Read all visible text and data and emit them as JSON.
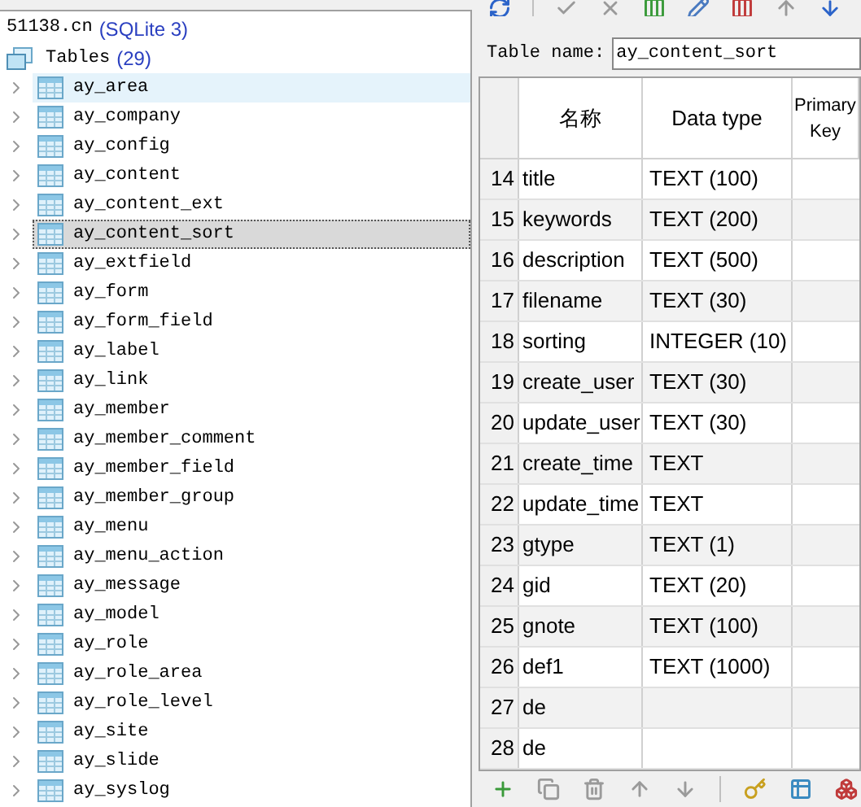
{
  "database": {
    "name": "51138.cn",
    "engine": "(SQLite 3)"
  },
  "tables_node": {
    "label": "Tables",
    "count": "(29)"
  },
  "tables": [
    {
      "name": "ay_area",
      "selected": false,
      "hovered": true
    },
    {
      "name": "ay_company",
      "selected": false,
      "hovered": false
    },
    {
      "name": "ay_config",
      "selected": false,
      "hovered": false
    },
    {
      "name": "ay_content",
      "selected": false,
      "hovered": false
    },
    {
      "name": "ay_content_ext",
      "selected": false,
      "hovered": false
    },
    {
      "name": "ay_content_sort",
      "selected": true,
      "hovered": false
    },
    {
      "name": "ay_extfield",
      "selected": false,
      "hovered": false
    },
    {
      "name": "ay_form",
      "selected": false,
      "hovered": false
    },
    {
      "name": "ay_form_field",
      "selected": false,
      "hovered": false
    },
    {
      "name": "ay_label",
      "selected": false,
      "hovered": false
    },
    {
      "name": "ay_link",
      "selected": false,
      "hovered": false
    },
    {
      "name": "ay_member",
      "selected": false,
      "hovered": false
    },
    {
      "name": "ay_member_comment",
      "selected": false,
      "hovered": false
    },
    {
      "name": "ay_member_field",
      "selected": false,
      "hovered": false
    },
    {
      "name": "ay_member_group",
      "selected": false,
      "hovered": false
    },
    {
      "name": "ay_menu",
      "selected": false,
      "hovered": false
    },
    {
      "name": "ay_menu_action",
      "selected": false,
      "hovered": false
    },
    {
      "name": "ay_message",
      "selected": false,
      "hovered": false
    },
    {
      "name": "ay_model",
      "selected": false,
      "hovered": false
    },
    {
      "name": "ay_role",
      "selected": false,
      "hovered": false
    },
    {
      "name": "ay_role_area",
      "selected": false,
      "hovered": false
    },
    {
      "name": "ay_role_level",
      "selected": false,
      "hovered": false
    },
    {
      "name": "ay_site",
      "selected": false,
      "hovered": false
    },
    {
      "name": "ay_slide",
      "selected": false,
      "hovered": false
    },
    {
      "name": "ay_syslog",
      "selected": false,
      "hovered": false
    }
  ],
  "table_name": {
    "label": "Table name:",
    "value": "ay_content_sort"
  },
  "columns": [
    "名称",
    "Data type",
    "Primary Key"
  ],
  "rows": [
    {
      "num": "14",
      "name": "title",
      "type": "TEXT (100)"
    },
    {
      "num": "15",
      "name": "keywords",
      "type": "TEXT (200)"
    },
    {
      "num": "16",
      "name": "description",
      "type": "TEXT (500)"
    },
    {
      "num": "17",
      "name": "filename",
      "type": "TEXT (30)"
    },
    {
      "num": "18",
      "name": "sorting",
      "type": "INTEGER (10)"
    },
    {
      "num": "19",
      "name": "create_user",
      "type": "TEXT (30)"
    },
    {
      "num": "20",
      "name": "update_user",
      "type": "TEXT (30)"
    },
    {
      "num": "21",
      "name": "create_time",
      "type": "TEXT"
    },
    {
      "num": "22",
      "name": "update_time",
      "type": "TEXT"
    },
    {
      "num": "23",
      "name": "gtype",
      "type": "TEXT (1)"
    },
    {
      "num": "24",
      "name": "gid",
      "type": "TEXT (20)"
    },
    {
      "num": "25",
      "name": "gnote",
      "type": "TEXT (100)"
    },
    {
      "num": "26",
      "name": "def1",
      "type": "TEXT (1000)"
    },
    {
      "num": "27",
      "name": "de"
    },
    {
      "num": "28",
      "name": "de"
    }
  ]
}
